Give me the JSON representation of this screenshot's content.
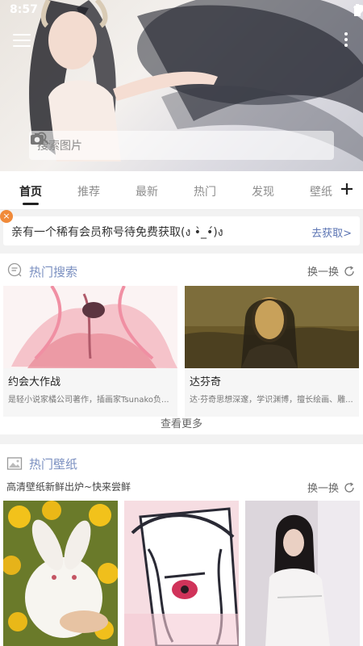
{
  "status": {
    "time": "8:57"
  },
  "search": {
    "placeholder": "搜索图片"
  },
  "tabs": [
    {
      "label": "首页",
      "active": true
    },
    {
      "label": "推荐"
    },
    {
      "label": "最新"
    },
    {
      "label": "热门"
    },
    {
      "label": "发现"
    },
    {
      "label": "壁纸"
    }
  ],
  "notice": {
    "text": "亲有一个稀有会员称号待免费获取(ง •̀_•́)ง",
    "link": "去获取>"
  },
  "hot_search": {
    "title": "热门搜索",
    "refresh_label": "换一换",
    "items": [
      {
        "name": "约会大作战",
        "desc": "是轻小说家橘公司著作，插画家Tsunako负..."
      },
      {
        "name": "达芬奇",
        "desc": "达·芬奇思想深邃，学识渊博，擅长绘画、雕..."
      }
    ],
    "more_label": "查看更多"
  },
  "hot_wallpaper": {
    "title": "热门壁纸",
    "subtitle": "高清壁纸新鲜出炉~快来尝鲜",
    "refresh_label": "换一换"
  },
  "colors": {
    "accent": "#7a8fc0",
    "notice_link": "#5b74b3",
    "close_badge": "#f08a3a"
  }
}
